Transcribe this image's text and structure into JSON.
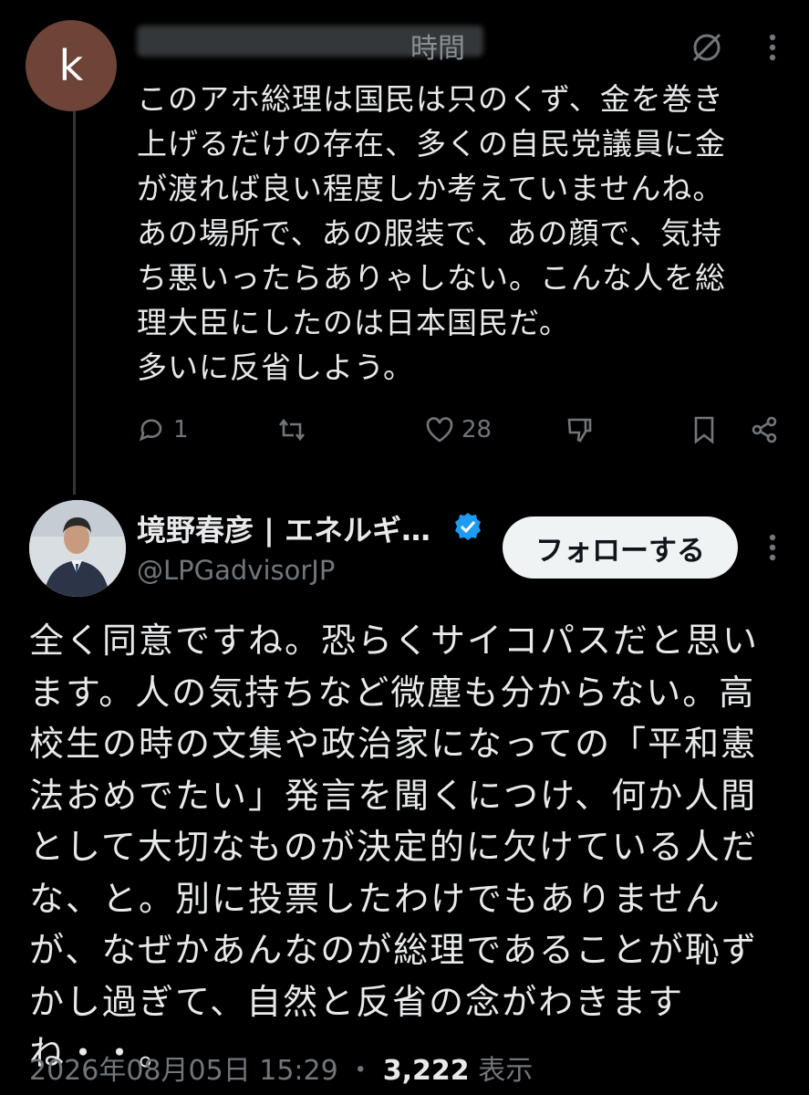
{
  "reply": {
    "avatar_letter": "k",
    "time_suffix": "時間",
    "text": "このアホ総理は国民は只のくず、金を巻き\n上げるだけの存在、多くの自民党議員に金\nが渡れば良い程度しか考えていませんね。\nあの場所で、あの服装で、あの顔で、気持\nち悪いったらありゃしない。こんな人を総\n理大臣にしたのは日本国民だ。\n多いに反省しよう。",
    "replies": "1",
    "likes": "28"
  },
  "post": {
    "author_name": "境野春彦 | エネルギ…",
    "handle": "@LPGadvisorJP",
    "follow_label": "フォローする",
    "text": "全く同意ですね。恐らくサイコパスだと思い\nます。人の気持ちなど微塵も分からない。高\n校生の時の文集や政治家になっての「平和憲\n法おめでたい」発言を聞くにつけ、何か人間\nとして大切なものが決定的に欠けている人だ\nな、と。別に投票したわけでもありません\nが、なぜかあんなのが総理であることが恥ず\nかし過ぎて、自然と反省の念がわきます\nね・・。",
    "date": "2026年08月05日 15:29",
    "separator": "・",
    "views": "3,222",
    "views_label": "表示"
  },
  "colors": {
    "background": "#000000",
    "muted": "#71767b",
    "verified": "#1d9bf0"
  }
}
